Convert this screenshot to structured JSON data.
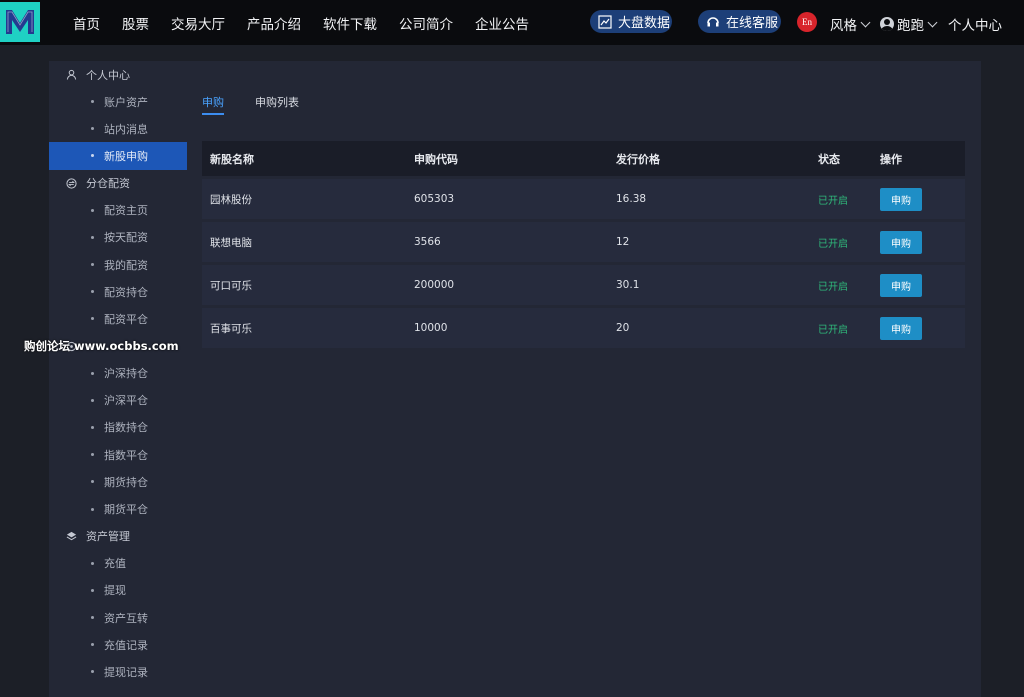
{
  "nav": {
    "items": [
      "首页",
      "股票",
      "交易大厅",
      "产品介绍",
      "软件下载",
      "公司简介",
      "企业公告"
    ],
    "bigdata_label": "大盘数据",
    "service_label": "在线客服",
    "lang_badge": "En",
    "style_label": "风格",
    "username": "跑跑",
    "personal_label": "个人中心"
  },
  "sidebar": {
    "groups": [
      {
        "label": "个人中心",
        "icon": "user-icon",
        "items": [
          "账户资产",
          "站内消息",
          "新股申购"
        ]
      },
      {
        "label": "分仓配资",
        "icon": "exchange-icon",
        "items": [
          "配资主页",
          "按天配资",
          "我的配资",
          "配资持仓",
          "配资平仓"
        ]
      },
      {
        "label": "",
        "icon": "settings-icon",
        "items": [
          "沪深持仓",
          "沪深平仓",
          "指数持仓",
          "指数平仓",
          "期货持仓",
          "期货平仓"
        ]
      },
      {
        "label": "资产管理",
        "icon": "layers-icon",
        "items": [
          "充值",
          "提现",
          "资产互转",
          "充值记录",
          "提现记录"
        ]
      }
    ],
    "active_item": "新股申购"
  },
  "tabs": [
    "申购",
    "申购列表"
  ],
  "active_tab": "申购",
  "table": {
    "headers": [
      "新股名称",
      "申购代码",
      "发行价格",
      "状态",
      "操作"
    ],
    "rows": [
      {
        "name": "园林股份",
        "code": "605303",
        "price": "16.38",
        "status": "已开启",
        "action": "申购"
      },
      {
        "name": "联想电脑",
        "code": "3566",
        "price": "12",
        "status": "已开启",
        "action": "申购"
      },
      {
        "name": "可口可乐",
        "code": "200000",
        "price": "30.1",
        "status": "已开启",
        "action": "申购"
      },
      {
        "name": "百事可乐",
        "code": "10000",
        "price": "20",
        "status": "已开启",
        "action": "申购"
      }
    ]
  },
  "watermark": "购创论坛 www.ocbbs.com",
  "colors": {
    "accent": "#1d57b7",
    "logo": "#1fd1c4",
    "status": "#2fb87a",
    "button": "#1e8ec6"
  }
}
